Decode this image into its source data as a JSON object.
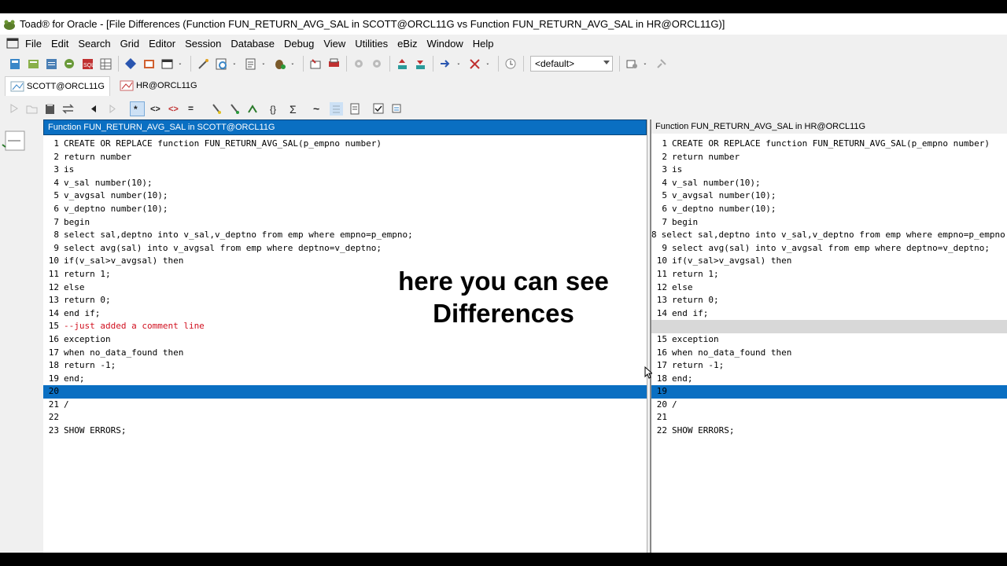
{
  "window": {
    "title": "Toad® for Oracle - [File Differences (Function FUN_RETURN_AVG_SAL in SCOTT@ORCL11G vs Function FUN_RETURN_AVG_SAL in HR@ORCL11G)]"
  },
  "menu": [
    "File",
    "Edit",
    "Search",
    "Grid",
    "Editor",
    "Session",
    "Database",
    "Debug",
    "View",
    "Utilities",
    "eBiz",
    "Window",
    "Help"
  ],
  "toolbar": {
    "combo_value": "<default>"
  },
  "connections": [
    {
      "label": "SCOTT@ORCL11G",
      "active": true
    },
    {
      "label": "HR@ORCL11G",
      "active": false
    }
  ],
  "left_pane": {
    "header": "Function FUN_RETURN_AVG_SAL in SCOTT@ORCL11G",
    "lines": [
      {
        "n": "1",
        "t": "CREATE OR REPLACE function FUN_RETURN_AVG_SAL(p_empno number)"
      },
      {
        "n": "2",
        "t": "return number"
      },
      {
        "n": "3",
        "t": "is"
      },
      {
        "n": "4",
        "t": "v_sal number(10);"
      },
      {
        "n": "5",
        "t": "v_avgsal number(10);"
      },
      {
        "n": "6",
        "t": "v_deptno number(10);"
      },
      {
        "n": "7",
        "t": "begin"
      },
      {
        "n": "8",
        "t": "select sal,deptno into v_sal,v_deptno from emp where empno=p_empno;"
      },
      {
        "n": "9",
        "t": "select avg(sal) into v_avgsal from emp where deptno=v_deptno;"
      },
      {
        "n": "10",
        "t": "if(v_sal>v_avgsal) then"
      },
      {
        "n": "11",
        "t": "return 1;"
      },
      {
        "n": "12",
        "t": "else"
      },
      {
        "n": "13",
        "t": "return 0;"
      },
      {
        "n": "14",
        "t": "end if;"
      },
      {
        "n": "15",
        "t": "--just added a comment line",
        "kind": "comment"
      },
      {
        "n": "16",
        "t": "exception"
      },
      {
        "n": "17",
        "t": "when no_data_found then"
      },
      {
        "n": "18",
        "t": "return -1;"
      },
      {
        "n": "19",
        "t": "end;"
      },
      {
        "n": "20",
        "t": "",
        "kind": "sel"
      },
      {
        "n": "21",
        "t": "/"
      },
      {
        "n": "22",
        "t": ""
      },
      {
        "n": "23",
        "t": "SHOW ERRORS;"
      }
    ]
  },
  "right_pane": {
    "header": "Function FUN_RETURN_AVG_SAL in HR@ORCL11G",
    "lines": [
      {
        "n": "1",
        "t": "CREATE OR REPLACE function FUN_RETURN_AVG_SAL(p_empno number)"
      },
      {
        "n": "2",
        "t": "return number"
      },
      {
        "n": "3",
        "t": "is"
      },
      {
        "n": "4",
        "t": "v_sal number(10);"
      },
      {
        "n": "5",
        "t": "v_avgsal number(10);"
      },
      {
        "n": "6",
        "t": "v_deptno number(10);"
      },
      {
        "n": "7",
        "t": "begin"
      },
      {
        "n": "8",
        "t": "select sal,deptno into v_sal,v_deptno from emp where empno=p_empno;"
      },
      {
        "n": "9",
        "t": "select avg(sal) into v_avgsal from emp where deptno=v_deptno;"
      },
      {
        "n": "10",
        "t": "if(v_sal>v_avgsal) then"
      },
      {
        "n": "11",
        "t": "return 1;"
      },
      {
        "n": "12",
        "t": "else"
      },
      {
        "n": "13",
        "t": "return 0;"
      },
      {
        "n": "14",
        "t": "end if;"
      },
      {
        "n": "",
        "t": "",
        "kind": "gap"
      },
      {
        "n": "15",
        "t": "exception"
      },
      {
        "n": "16",
        "t": "when no_data_found then"
      },
      {
        "n": "17",
        "t": "return -1;"
      },
      {
        "n": "18",
        "t": "end;"
      },
      {
        "n": "19",
        "t": "",
        "kind": "sel"
      },
      {
        "n": "20",
        "t": "/"
      },
      {
        "n": "21",
        "t": ""
      },
      {
        "n": "22",
        "t": "SHOW ERRORS;"
      }
    ]
  },
  "overlay_text": {
    "line1": "here you can see",
    "line2": "Differences"
  },
  "colors": {
    "selection": "#0a6fc2",
    "comment": "#d1101f",
    "gap": "#d8d8d8"
  }
}
